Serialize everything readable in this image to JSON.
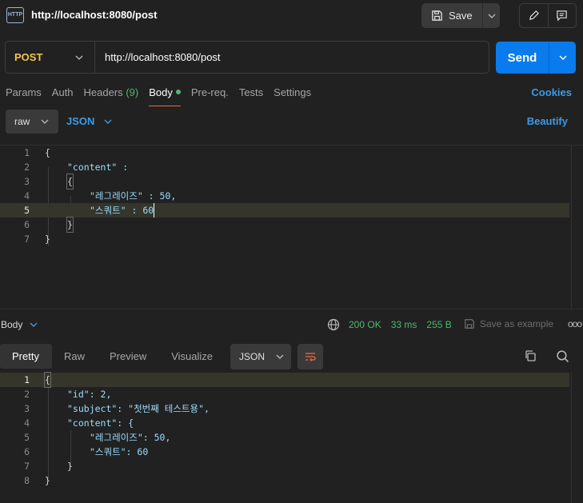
{
  "window": {
    "title": "http://localhost:8080/post",
    "http_badge": "HTTP",
    "save_label": "Save"
  },
  "request": {
    "method": "POST",
    "method_color": "#f5c54b",
    "url": "http://localhost:8080/post",
    "send_label": "Send"
  },
  "tabs": {
    "params": "Params",
    "auth": "Auth",
    "headers": "Headers",
    "headers_count": "(9)",
    "body": "Body",
    "prereq": "Pre-req.",
    "tests": "Tests",
    "settings": "Settings",
    "cookies": "Cookies"
  },
  "body_options": {
    "mode": "raw",
    "language": "JSON",
    "beautify": "Beautify"
  },
  "request_body": {
    "lines": [
      {
        "n": "1",
        "text": "{"
      },
      {
        "n": "2",
        "text": "\"content\" :"
      },
      {
        "n": "3",
        "text": "{"
      },
      {
        "n": "4",
        "text": "\"레그레이즈\" : 50,"
      },
      {
        "n": "5",
        "text": "\"스쿼트\" : 60"
      },
      {
        "n": "6",
        "text": "}"
      },
      {
        "n": "7",
        "text": "}"
      }
    ]
  },
  "response": {
    "section_label": "Body",
    "status": "200 OK",
    "time": "33 ms",
    "size": "255 B",
    "save_example": "Save as example",
    "more": "ooo",
    "tabs": {
      "pretty": "Pretty",
      "raw": "Raw",
      "preview": "Preview",
      "visualize": "Visualize"
    },
    "format": "JSON",
    "lines": [
      {
        "n": "1",
        "text": "{"
      },
      {
        "n": "2",
        "text": "\"id\": 2,"
      },
      {
        "n": "3",
        "text": "\"subject\": \"첫번째 테스트용\","
      },
      {
        "n": "4",
        "text": "\"content\": {"
      },
      {
        "n": "5",
        "text": "\"레그레이즈\": 50,"
      },
      {
        "n": "6",
        "text": "\"스쿼트\": 60"
      },
      {
        "n": "7",
        "text": "}"
      },
      {
        "n": "8",
        "text": "}"
      }
    ]
  },
  "colors": {
    "accent": "#097bed",
    "link": "#3d9ae8",
    "success": "#4fb86f",
    "active_tab_underline": "#f06b3b"
  }
}
